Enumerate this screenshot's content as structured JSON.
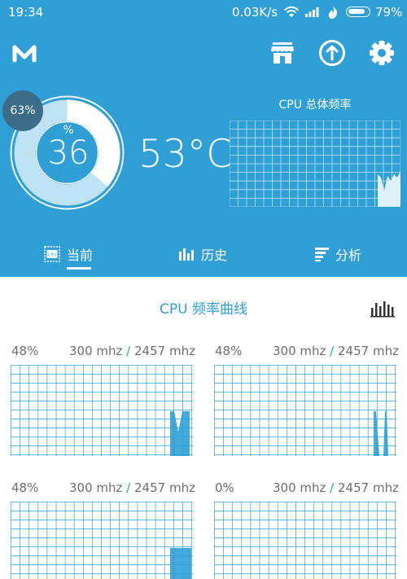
{
  "status_bar": {
    "time": "19:34",
    "network_speed": "0.03K/s",
    "battery": "79%"
  },
  "header": {
    "logo_icon": "m-logo-icon",
    "buttons": [
      {
        "name": "store-icon"
      },
      {
        "name": "upload-icon"
      },
      {
        "name": "gear-icon"
      }
    ]
  },
  "dashboard": {
    "cpu_load_badge": "63%",
    "gauge_unit": "%",
    "gauge_value": "36",
    "gauge_fill": 0.36,
    "temperature": "53°C",
    "freq_title": "CPU 总体频率"
  },
  "tabs": [
    {
      "label": "当前",
      "icon": "cpu-chip-icon",
      "active": true
    },
    {
      "label": "历史",
      "icon": "bar-chart-icon",
      "active": false
    },
    {
      "label": "分析",
      "icon": "list-sort-icon",
      "active": false
    }
  ],
  "section": {
    "title": "CPU 频率曲线",
    "icon": "bar-chart-icon"
  },
  "cores": [
    {
      "usage": "48%",
      "cur": "300 mhz",
      "max": "2457 mhz"
    },
    {
      "usage": "48%",
      "cur": "300 mhz",
      "max": "2457 mhz"
    },
    {
      "usage": "48%",
      "cur": "300 mhz",
      "max": "2457 mhz"
    },
    {
      "usage": "0%",
      "cur": "300 mhz",
      "max": "2457 mhz"
    }
  ],
  "colors": {
    "primary": "#2f9fd6",
    "badge": "#3c6c88",
    "text_gray": "#6f6f6f",
    "grid_light": "#9fd3ee"
  }
}
